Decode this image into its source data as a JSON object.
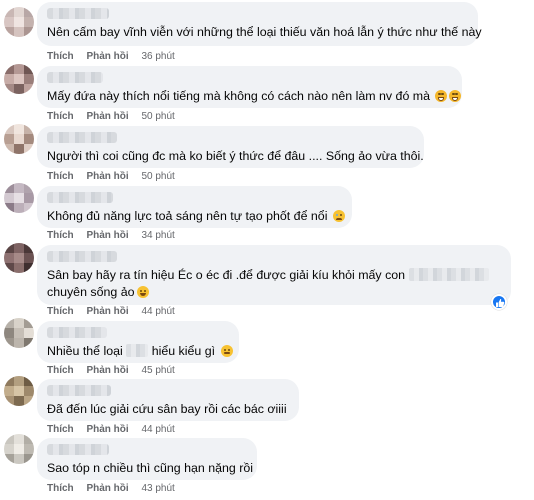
{
  "labels": {
    "like": "Thích",
    "reply": "Phản hồi"
  },
  "comments": [
    {
      "text": "Nên cấm bay vĩnh viễn với những thể loại thiếu văn hoá lẫn ý thức như thế này",
      "time": "36 phút"
    },
    {
      "text": "Mấy đứa này thích nổi tiếng mà không có cách nào nên làm nv đó mà",
      "time": "50 phút"
    },
    {
      "text": "Người thì coi cũng đc mà ko biết ý thức để đâu .... Sống ảo vừa thôi.",
      "time": "50 phút"
    },
    {
      "text": "Không đủ năng lực toả sáng nên tự tạo phốt để nổi",
      "time": "34 phút"
    },
    {
      "text_line1_a": "Sân bay hãy ra tín hiệu Éc o éc đi .để được giải kíu khỏi mấy con",
      "text_line2": "chuyên sống ảo",
      "time": "44 phút"
    },
    {
      "text_a": "Nhiều thể loại",
      "text_b": "hiểu kiểu gì",
      "time": "45 phút"
    },
    {
      "text": "Đã đến lúc giải cứu sân bay rồi các bác ơiiii",
      "time": "44 phút"
    },
    {
      "text": "Sao tóp n chiều thì cũng hạn nặng rồi",
      "time": "43 phút"
    }
  ],
  "icons": [
    "laughing-tears-emoji",
    "sad-emoji",
    "smile-emoji",
    "grimace-emoji",
    "like-reaction-icon"
  ],
  "colors": {
    "bubble": "#f0f2f5",
    "action_text": "#65676b",
    "like_blue": "#1877f2"
  }
}
